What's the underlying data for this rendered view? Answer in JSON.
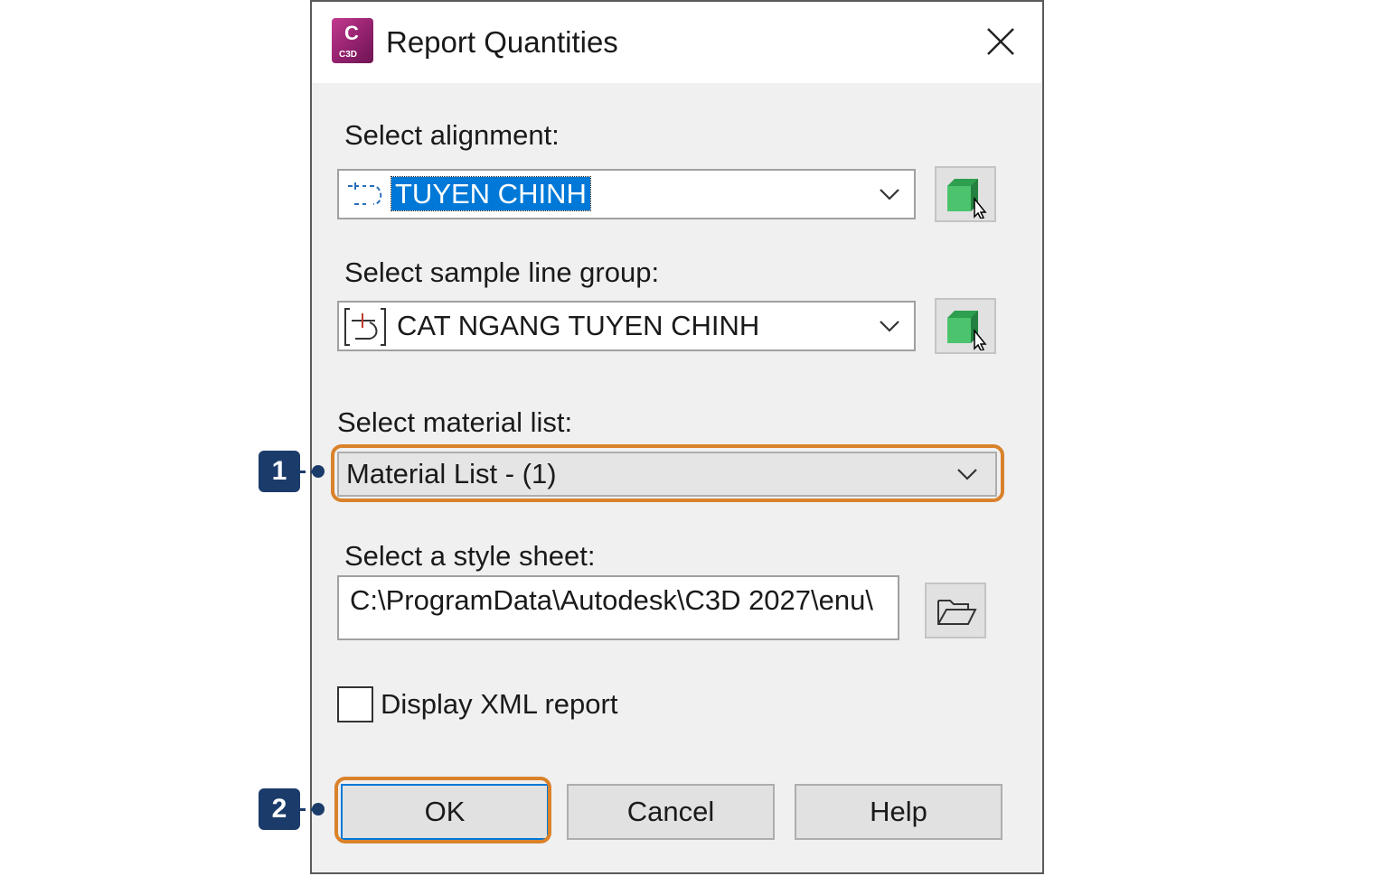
{
  "dialog": {
    "title": "Report Quantities",
    "app_icon_letter": "C",
    "app_icon_sub": "C3D"
  },
  "alignment": {
    "label": "Select alignment:",
    "value": "TUYEN CHINH"
  },
  "sample_line_group": {
    "label": "Select sample line group:",
    "value": "CAT NGANG TUYEN CHINH"
  },
  "material_list": {
    "label": "Select material list:",
    "value": "Material List - (1)"
  },
  "style_sheet": {
    "label": "Select a style sheet:",
    "value": "C:\\ProgramData\\Autodesk\\C3D 2027\\enu\\"
  },
  "display_xml": {
    "label": "Display XML report",
    "checked": false
  },
  "buttons": {
    "ok": "OK",
    "cancel": "Cancel",
    "help": "Help"
  },
  "callouts": {
    "one": "1",
    "two": "2"
  },
  "colors": {
    "highlight": "#d9822b",
    "callout": "#1b3c6b",
    "selection": "#0078d7"
  }
}
